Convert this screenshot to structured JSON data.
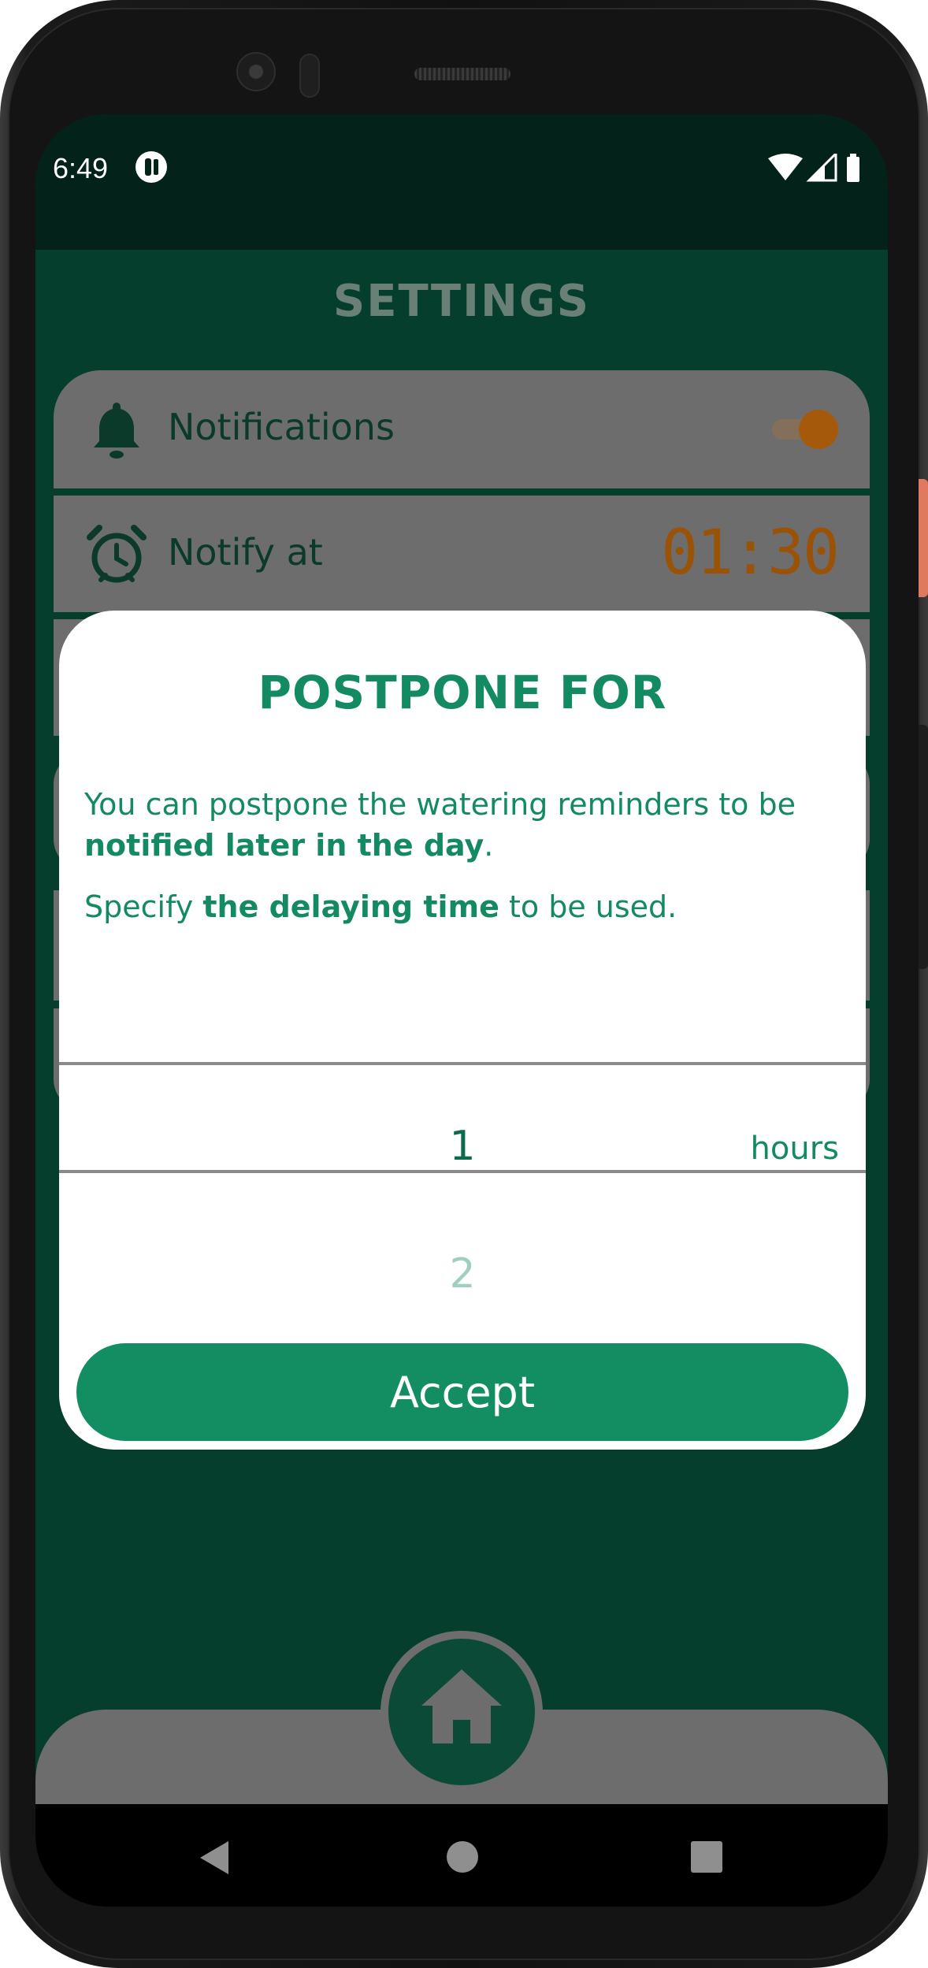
{
  "status_bar": {
    "time": "6:49",
    "app_icon": "app-notification-icon",
    "wifi_icon": "wifi-icon",
    "signal_icon": "signal-icon",
    "battery_icon": "battery-icon"
  },
  "settings": {
    "title": "SETTINGS",
    "items": [
      {
        "label": "Notifications",
        "icon": "bell-icon",
        "toggle_on": true
      },
      {
        "label": "Notify at",
        "icon": "alarm-clock-icon",
        "value": "01:30"
      }
    ]
  },
  "dialog": {
    "title": "POSTPONE FOR",
    "paragraph1_part1": "You can postpone the watering reminders to be ",
    "paragraph1_bold": "notified later in the day",
    "paragraph1_end": ".",
    "paragraph2_part1": "Specify ",
    "paragraph2_bold": "the delaying time",
    "paragraph2_end": " to be used.",
    "picker": {
      "selected": "1",
      "next": "2",
      "unit": "hours"
    },
    "accept_label": "Accept"
  },
  "bottom_nav": {
    "home_icon": "home-icon"
  },
  "system_nav": {
    "back_icon": "back-triangle-icon",
    "home_icon": "home-circle-icon",
    "recent_icon": "recent-square-icon"
  },
  "colors": {
    "brand_green": "#138e63",
    "screen_bg": "#053e2c",
    "accent_orange": "#9a5306"
  }
}
